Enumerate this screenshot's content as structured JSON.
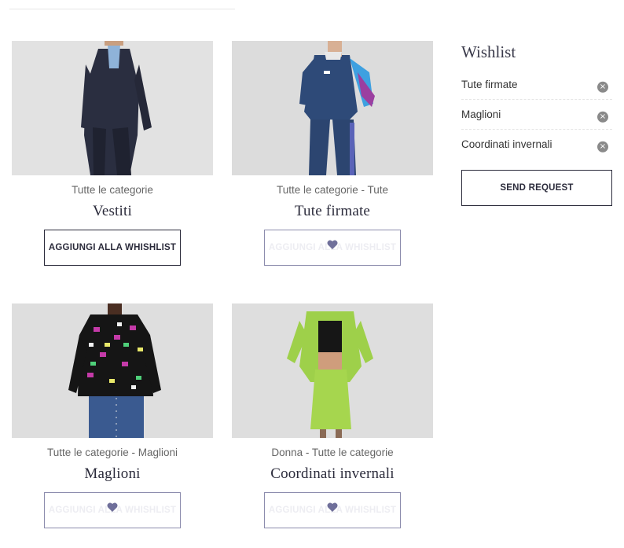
{
  "products": [
    {
      "category": "Tutte le categorie",
      "title": "Vestiti",
      "button_label": "AGGIUNGI ALLA WHISHLIST",
      "in_wishlist": false
    },
    {
      "category": "Tutte le categorie - Tute",
      "title": "Tute firmate",
      "button_label": "AGGIUNGI ALLA WHISHLIST",
      "in_wishlist": true
    },
    {
      "category": "Tutte le categorie - Maglioni",
      "title": "Maglioni",
      "button_label": "AGGIUNGI ALLA WHISHLIST",
      "in_wishlist": true
    },
    {
      "category": "Donna - Tutte le categorie",
      "title": "Coordinati invernali",
      "button_label": "AGGIUNGI ALLA WHISHLIST",
      "in_wishlist": true
    }
  ],
  "wishlist": {
    "title": "Wishlist",
    "items": [
      {
        "label": "Tute firmate"
      },
      {
        "label": "Maglioni"
      },
      {
        "label": "Coordinati invernali"
      }
    ],
    "remove_icon": "×",
    "send_label": "SEND REQUEST"
  },
  "colors": {
    "accent": "#2b2b3b",
    "heart": "#6f6f9a",
    "added_border": "#8c8cad"
  }
}
